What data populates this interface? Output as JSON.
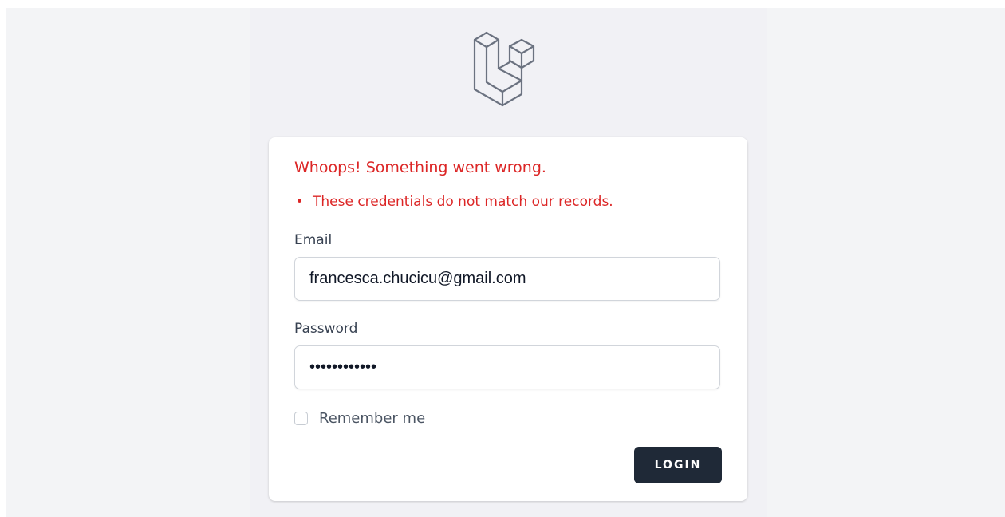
{
  "errors": {
    "title": "Whoops! Something went wrong.",
    "items": [
      "These credentials do not match our records."
    ]
  },
  "form": {
    "email": {
      "label": "Email",
      "value": "francesca.chucicu@gmail.com"
    },
    "password": {
      "label": "Password",
      "value": "123456789012"
    },
    "remember": {
      "label": "Remember me",
      "checked": false
    },
    "submit_label": "LOGIN"
  },
  "colors": {
    "error": "#dc2626",
    "button": "#1f2937",
    "logo_stroke": "#6b7280",
    "page_background": "#f3f4f6"
  },
  "icons": {
    "logo": "laravel-logo-icon"
  }
}
